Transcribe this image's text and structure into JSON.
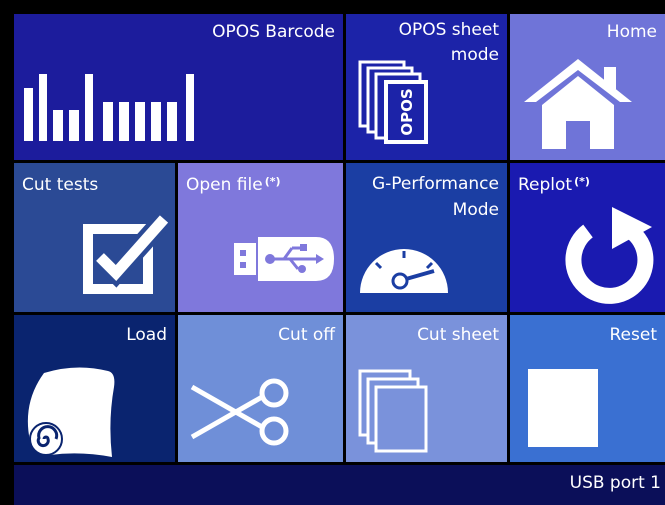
{
  "tiles": [
    {
      "id": "opos-barcode",
      "label": "OPOS Barcode",
      "color": "#1c1c9c",
      "icon": "barcode-icon"
    },
    {
      "id": "opos-sheet-mode",
      "label_line1": "OPOS sheet",
      "label_line2": "mode",
      "color": "#1c23a8",
      "icon": "opos-sheet-icon"
    },
    {
      "id": "home",
      "label": "Home",
      "color": "#6f74d8",
      "icon": "home-icon"
    },
    {
      "id": "cut-tests",
      "label": "Cut tests",
      "color": "#2b4a95",
      "icon": "checkbox-icon"
    },
    {
      "id": "open-file",
      "label": "Open file",
      "marker": "(*)",
      "color": "#7f78dc",
      "icon": "usb-icon"
    },
    {
      "id": "g-performance-mode",
      "label_line1": "G-Performance",
      "label_line2": "Mode",
      "color": "#1b3ea3",
      "icon": "gauge-icon"
    },
    {
      "id": "replot",
      "label": "Replot",
      "marker": "(*)",
      "color": "#1a1ab0",
      "icon": "replot-icon"
    },
    {
      "id": "load",
      "label": "Load",
      "color": "#0a246f",
      "icon": "roll-icon"
    },
    {
      "id": "cut-off",
      "label": "Cut off",
      "color": "#6f8fd8",
      "icon": "scissors-icon"
    },
    {
      "id": "cut-sheet",
      "label": "Cut sheet",
      "color": "#7a92db",
      "icon": "sheets-icon"
    },
    {
      "id": "reset",
      "label": "Reset",
      "color": "#3a70d2",
      "icon": "square-icon"
    }
  ],
  "status": {
    "text": "USB port 1"
  }
}
